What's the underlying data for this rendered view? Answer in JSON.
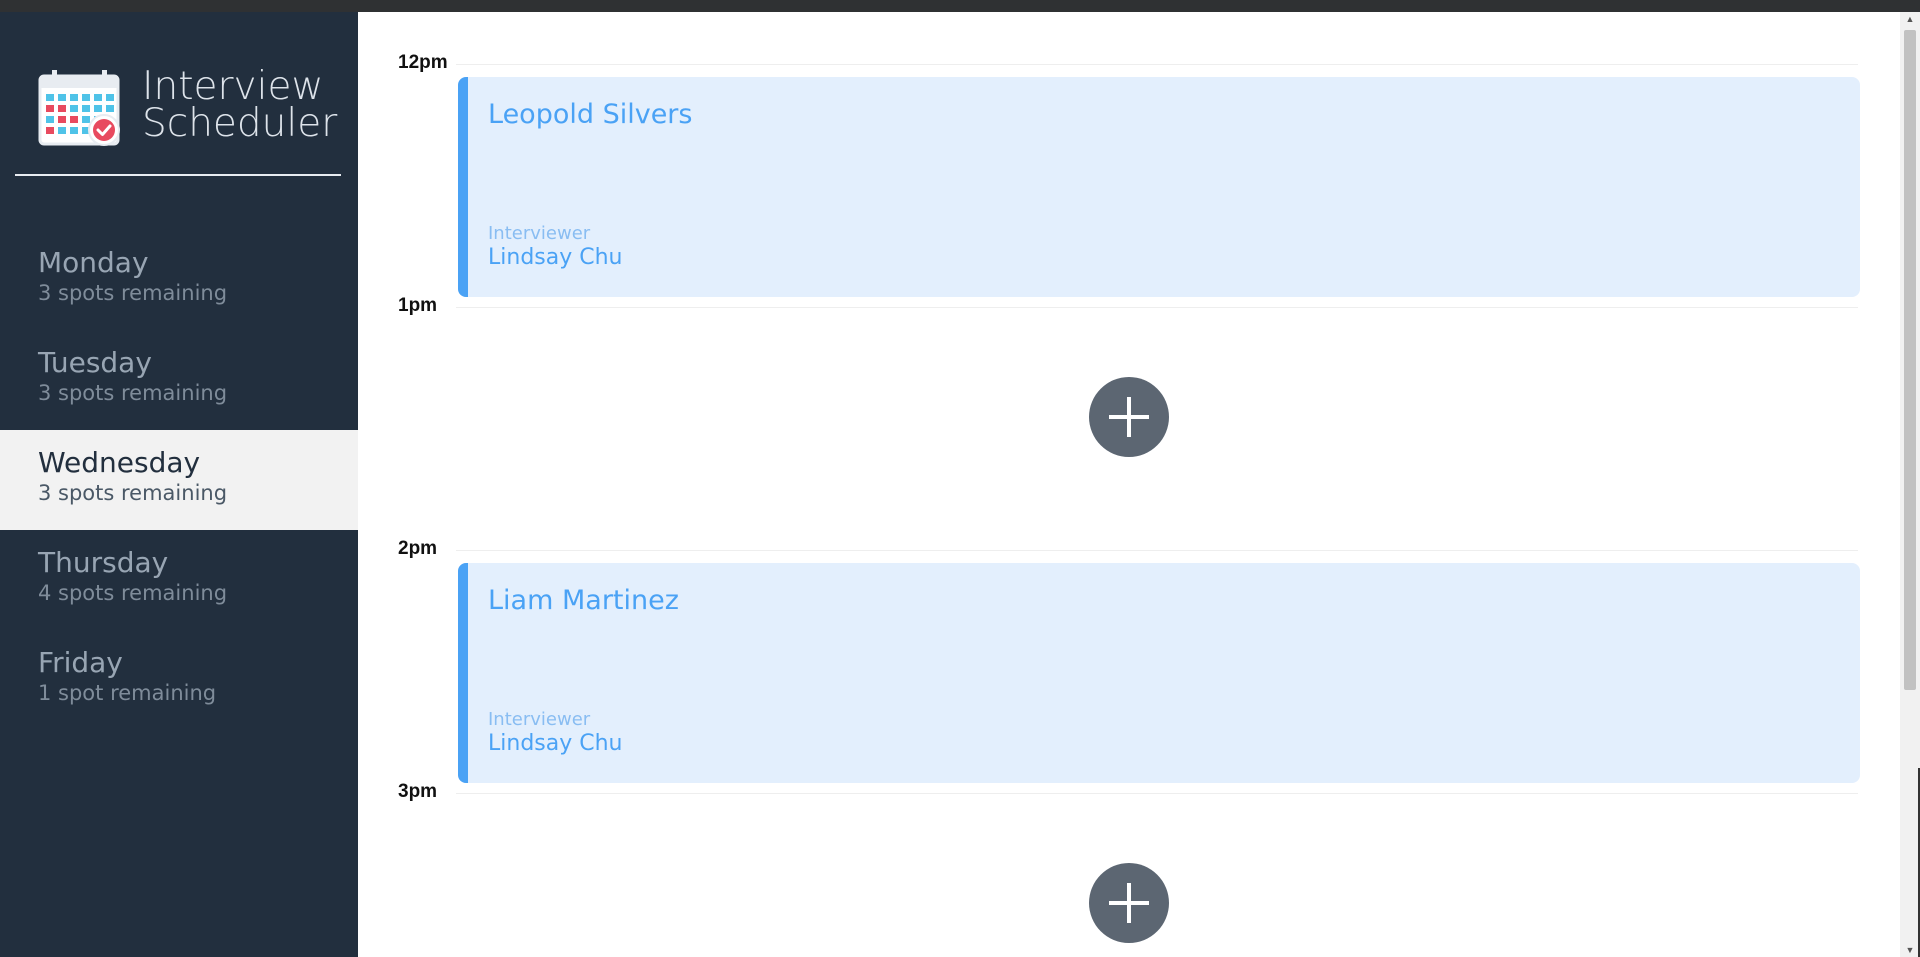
{
  "app": {
    "title_line1": "Interview",
    "title_line2": "Scheduler",
    "logo_icon": "calendar-icon"
  },
  "sidebar": {
    "days": [
      {
        "name": "Monday",
        "spots": "3 spots remaining",
        "selected": false
      },
      {
        "name": "Tuesday",
        "spots": "3 spots remaining",
        "selected": false
      },
      {
        "name": "Wednesday",
        "spots": "3 spots remaining",
        "selected": true
      },
      {
        "name": "Thursday",
        "spots": "4 spots remaining",
        "selected": false
      },
      {
        "name": "Friday",
        "spots": "1 spot remaining",
        "selected": false
      }
    ]
  },
  "schedule": {
    "slots": [
      {
        "time": "12pm",
        "type": "booked",
        "student": "Leopold Silvers",
        "interviewer_label": "Interviewer",
        "interviewer": "Lindsay Chu"
      },
      {
        "time": "1pm",
        "type": "empty",
        "add_icon": "plus-icon"
      },
      {
        "time": "2pm",
        "type": "booked",
        "student": "Liam Martinez",
        "interviewer_label": "Interviewer",
        "interviewer": "Lindsay Chu"
      },
      {
        "time": "3pm",
        "type": "empty",
        "add_icon": "plus-icon"
      }
    ]
  },
  "colors": {
    "sidebar_bg": "#222f3e",
    "selected_day_bg": "#f2f2f2",
    "card_bg": "#e3effd",
    "card_accent": "#4aa2f5",
    "add_button_bg": "#5c6672"
  }
}
